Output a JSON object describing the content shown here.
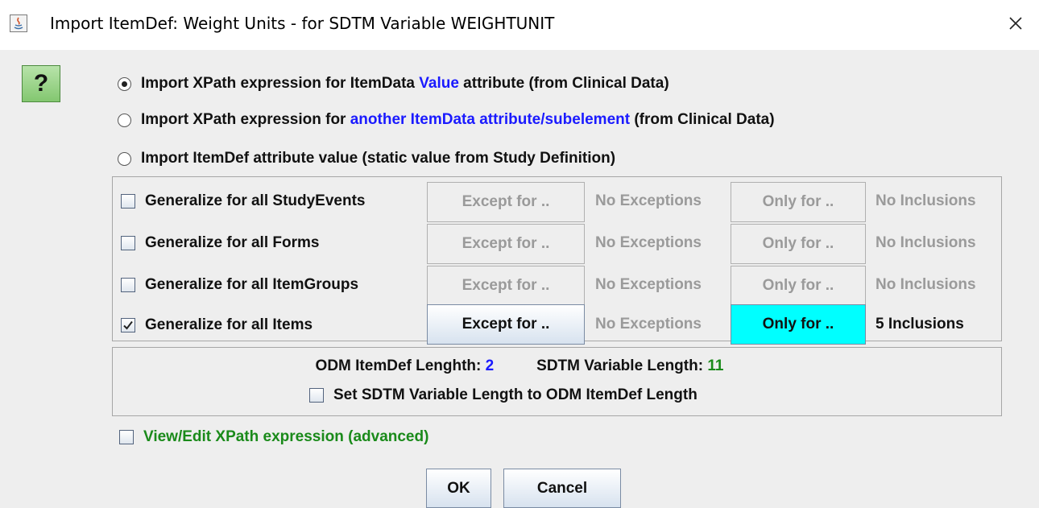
{
  "window": {
    "title": "Import ItemDef: Weight Units - for SDTM Variable WEIGHTUNIT",
    "close_symbol": "✕",
    "icon": "java-app-icon"
  },
  "help": {
    "label": "?"
  },
  "radios": [
    {
      "before": "Import XPath expression for ItemData ",
      "highlight": "Value",
      "after": " attribute (from Clinical Data)",
      "selected": true
    },
    {
      "before": "Import XPath expression for ",
      "highlight": "another ItemData attribute/subelement",
      "after": " (from Clinical Data)",
      "selected": false
    },
    {
      "before": "Import ItemDef attribute value (static value from Study Definition)",
      "highlight": "",
      "after": "",
      "selected": false
    }
  ],
  "generalize": [
    {
      "label": "Generalize for all StudyEvents",
      "checked": false,
      "except_label": "Except for ..",
      "exceptions": "No Exceptions",
      "only_label": "Only for ..",
      "inclusions": "No Inclusions",
      "enabled": false
    },
    {
      "label": "Generalize for all Forms",
      "checked": false,
      "except_label": "Except for ..",
      "exceptions": "No Exceptions",
      "only_label": "Only for ..",
      "inclusions": "No Inclusions",
      "enabled": false
    },
    {
      "label": "Generalize for all ItemGroups",
      "checked": false,
      "except_label": "Except for ..",
      "exceptions": "No Exceptions",
      "only_label": "Only for ..",
      "inclusions": "No Inclusions",
      "enabled": false
    },
    {
      "label": "Generalize for all Items",
      "checked": true,
      "except_label": "Except for ..",
      "exceptions": "No Exceptions",
      "only_label": "Only for ..",
      "inclusions": "5 Inclusions",
      "enabled": true
    }
  ],
  "length": {
    "odm_label": "ODM ItemDef Lenghth: ",
    "odm_value": "2",
    "sdtm_label": "SDTM Variable Length: ",
    "sdtm_value": "11",
    "set_label": "Set SDTM Variable Length to ODM ItemDef Length",
    "set_checked": false
  },
  "xpath": {
    "label": "View/Edit XPath expression (advanced)",
    "checked": false
  },
  "buttons": {
    "ok": "OK",
    "cancel": "Cancel"
  },
  "colors": {
    "value_blue": "#1a1aff",
    "odm_blue": "#1a1aff",
    "sdtm_green": "#1a8a1a",
    "xpath_green": "#1a8a1a",
    "only_for_active": "#00ffff",
    "help_green": "#83c770"
  }
}
